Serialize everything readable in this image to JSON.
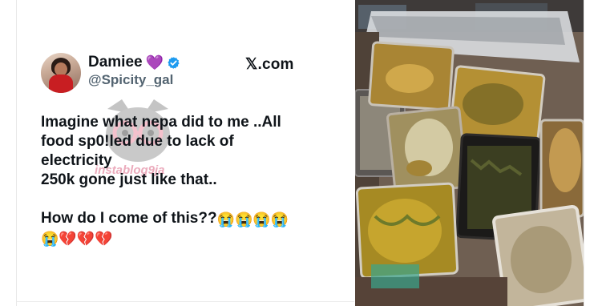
{
  "tweet": {
    "display_name": "Damiee",
    "name_emoji": "💜",
    "handle": "@Spicity_gal",
    "brand": "𝕏.com",
    "lines": [
      "Imagine what nepa did to me ..All",
      "food sp0!led due to lack of",
      "electricity",
      "250k gone just like that.."
    ],
    "question": "How do I come of this??",
    "crying_emojis": [
      "😭",
      "😭",
      "😭",
      "😭",
      "😭"
    ],
    "broken_hearts": [
      "💔",
      "💔",
      "💔"
    ]
  },
  "watermark": {
    "text": "instablog9ja"
  },
  "icons": {
    "verified": "verified-badge-icon",
    "avatar": "profile-avatar"
  },
  "colors": {
    "text": "#0f1419",
    "handle": "#536471",
    "verified": "#1d9bf0",
    "heart": "#9b51e0"
  }
}
